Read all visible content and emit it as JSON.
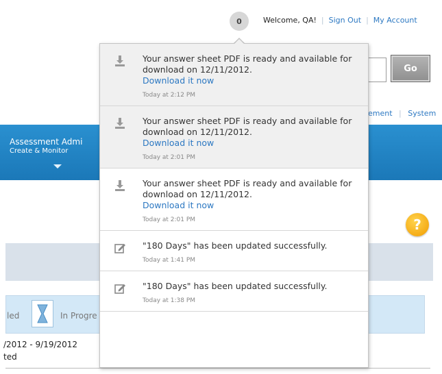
{
  "header": {
    "notification_count": "0",
    "welcome": "Welcome, QA!",
    "sign_out": "Sign Out",
    "my_account": "My Account"
  },
  "search": {
    "go_label": "Go"
  },
  "subnav": {
    "item1": "ement",
    "item2": "System"
  },
  "nav": {
    "tab_title": "Assessment Admi",
    "tab_subtitle": "Create & Monitor"
  },
  "help": {
    "label": "?"
  },
  "status": {
    "label1": "led",
    "label2": "In Progre",
    "date_range": "/2012 - 9/19/2012",
    "date_status": "ted"
  },
  "notifications": [
    {
      "type": "download",
      "message": "Your answer sheet PDF is ready and available for download on 12/11/2012.",
      "link": "Download it now",
      "time": "Today at 2:12 PM"
    },
    {
      "type": "download",
      "message": "Your answer sheet PDF is ready and available for download on 12/11/2012.",
      "link": "Download it now",
      "time": "Today at 2:01 PM"
    },
    {
      "type": "download",
      "message": "Your answer sheet PDF is ready and available for download on 12/11/2012.",
      "link": "Download it now",
      "time": "Today at 2:01 PM"
    },
    {
      "type": "edit",
      "message": "\"180 Days\" has been updated successfully.",
      "time": "Today at 1:41 PM"
    },
    {
      "type": "edit",
      "message": "\"180 Days\" has been updated successfully.",
      "time": "Today at 1:38 PM"
    }
  ],
  "colors": {
    "link": "#2c78c2",
    "nav_band": "#2a90d0",
    "help": "#f19c00"
  }
}
